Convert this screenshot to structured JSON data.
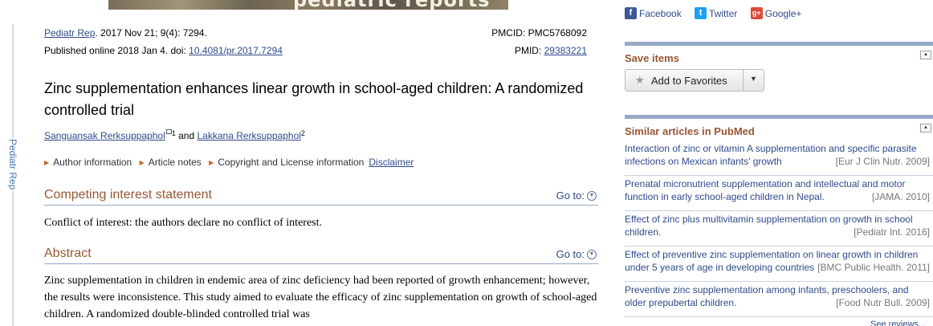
{
  "sidebar_rail": {
    "label": "Pediatr Rep"
  },
  "banner": {
    "text": "pediatric reports"
  },
  "citation": {
    "journal": "Pediatr Rep",
    "date_vol": ". 2017 Nov 21; 9(4): 7294.",
    "published_prefix": "Published online 2018 Jan 4. doi: ",
    "doi": "10.4081/pr.2017.7294",
    "pmcid": "PMCID: PMC5768092",
    "pmid_label": "PMID: ",
    "pmid": "29383221"
  },
  "article": {
    "title": "Zinc supplementation enhances linear growth in school-aged children: A randomized controlled trial",
    "author1": "Sanguansak Rerksuppaphol",
    "author1_sup": "1",
    "and": " and ",
    "author2": "Lakkana Rerksuppaphol",
    "author2_sup": "2"
  },
  "notes": {
    "author_information": "Author information",
    "article_notes": "Article notes",
    "copyright": "Copyright and License information",
    "disclaimer": "Disclaimer"
  },
  "sections": {
    "goto_label": "Go to:",
    "competing": {
      "heading": "Competing interest statement",
      "text": "Conflict of interest: the authors declare no conflict of interest."
    },
    "abstract": {
      "heading": "Abstract",
      "text": "Zinc supplementation in children in endemic area of zinc deficiency had been reported of growth enhancement; however, the results were inconsistence. This study aimed to evaluate the efficacy of zinc supplementation on growth of school-aged children. A randomized double-blinded controlled trial was"
    }
  },
  "share": {
    "facebook": "Facebook",
    "twitter": "Twitter",
    "google": "Google+"
  },
  "save_items": {
    "heading": "Save items",
    "button_label": "Add to Favorites"
  },
  "similar": {
    "heading": "Similar articles in PubMed",
    "items": [
      {
        "title": "Interaction of zinc or vitamin A supplementation and specific parasite infections on Mexican infants' growth",
        "source": "[Eur J Clin Nutr. 2009]"
      },
      {
        "title": "Prenatal micronutrient supplementation and intellectual and motor function in early school-aged children in Nepal.",
        "source": "[JAMA. 2010]"
      },
      {
        "title": "Effect of zinc plus multivitamin supplementation on growth in school children.",
        "source": "[Pediatr Int. 2016]"
      },
      {
        "title": "Effect of preventive zinc supplementation on linear growth in children under 5 years of age in developing countries",
        "source": "[BMC Public Health. 2011]"
      },
      {
        "title": "Preventive zinc supplementation among infants, preschoolers, and older prepubertal children.",
        "source": "[Food Nutr Bull. 2009]"
      }
    ],
    "see_reviews": "See reviews..."
  },
  "colors": {
    "section_heading": "#985735",
    "link": "#2f4a8a",
    "rule": "#97a9c9"
  }
}
